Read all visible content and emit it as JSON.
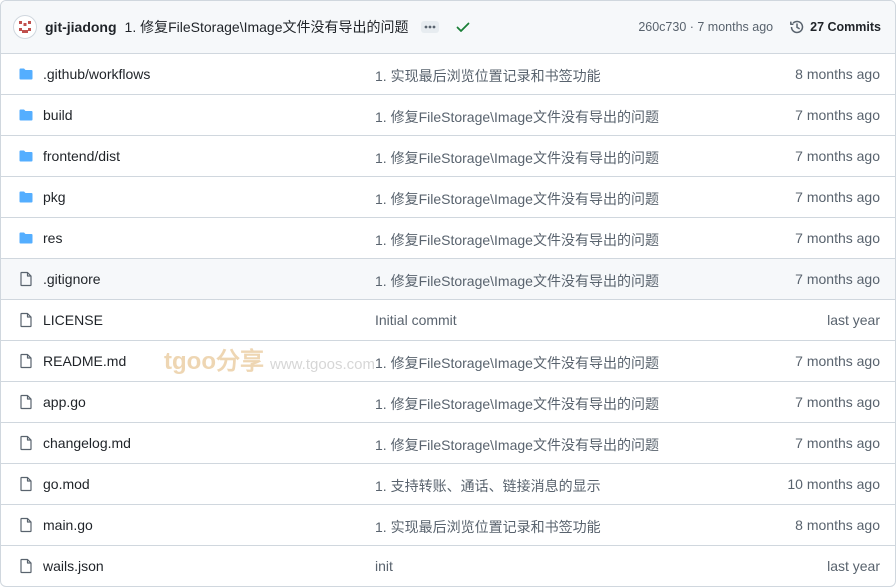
{
  "header": {
    "author": "git-jiadong",
    "commit_message": "1. 修复FileStorage\\Image文件没有导出的问题",
    "sha_age": "260c730 · 7 months ago",
    "commits_label": "27 Commits"
  },
  "files": [
    {
      "name": ".github/workflows",
      "type": "folder",
      "message": "1. 实现最后浏览位置记录和书签功能",
      "age": "8 months ago"
    },
    {
      "name": "build",
      "type": "folder",
      "message": "1. 修复FileStorage\\Image文件没有导出的问题",
      "age": "7 months ago"
    },
    {
      "name": "frontend/dist",
      "type": "folder",
      "message": "1. 修复FileStorage\\Image文件没有导出的问题",
      "age": "7 months ago"
    },
    {
      "name": "pkg",
      "type": "folder",
      "message": "1. 修复FileStorage\\Image文件没有导出的问题",
      "age": "7 months ago"
    },
    {
      "name": "res",
      "type": "folder",
      "message": "1. 修复FileStorage\\Image文件没有导出的问题",
      "age": "7 months ago"
    },
    {
      "name": ".gitignore",
      "type": "file",
      "message": "1. 修复FileStorage\\Image文件没有导出的问题",
      "age": "7 months ago"
    },
    {
      "name": "LICENSE",
      "type": "file",
      "message": "Initial commit",
      "age": "last year"
    },
    {
      "name": "README.md",
      "type": "file",
      "message": "1. 修复FileStorage\\Image文件没有导出的问题",
      "age": "7 months ago"
    },
    {
      "name": "app.go",
      "type": "file",
      "message": "1. 修复FileStorage\\Image文件没有导出的问题",
      "age": "7 months ago"
    },
    {
      "name": "changelog.md",
      "type": "file",
      "message": "1. 修复FileStorage\\Image文件没有导出的问题",
      "age": "7 months ago"
    },
    {
      "name": "go.mod",
      "type": "file",
      "message": "1. 支持转账、通话、链接消息的显示",
      "age": "10 months ago"
    },
    {
      "name": "main.go",
      "type": "file",
      "message": "1. 实现最后浏览位置记录和书签功能",
      "age": "8 months ago"
    },
    {
      "name": "wails.json",
      "type": "file",
      "message": "init",
      "age": "last year"
    }
  ],
  "watermark": {
    "brand": "tgoo分享",
    "url": "www.tgoos.com"
  },
  "colors": {
    "folder": "#54aeff",
    "file_icon": "#59636e",
    "check": "#1a7f37",
    "border": "#d0d7de"
  }
}
